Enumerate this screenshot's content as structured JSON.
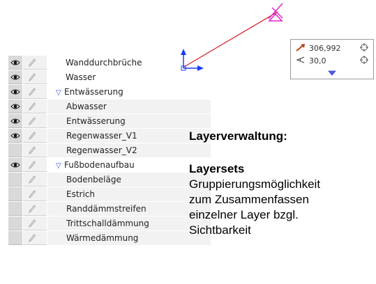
{
  "coord_box": {
    "length_value": "306,992",
    "angle_value": "30,0",
    "length_icon": "length-arrow-icon",
    "angle_icon": "angle-icon",
    "target_icon": "crosshair-icon",
    "expand_icon": "expand-triangle-icon"
  },
  "layers": [
    {
      "name": "Wanddurchbrüche",
      "visible": true,
      "group": false,
      "indent": 0
    },
    {
      "name": "Wasser",
      "visible": true,
      "group": false,
      "indent": 0
    },
    {
      "name": "Entwässerung",
      "visible": true,
      "group": true,
      "indent": 0
    },
    {
      "name": "Abwasser",
      "visible": true,
      "group": false,
      "indent": 1
    },
    {
      "name": "Entwässerung",
      "visible": true,
      "group": false,
      "indent": 1
    },
    {
      "name": "Regenwasser_V1",
      "visible": true,
      "group": false,
      "indent": 1
    },
    {
      "name": "Regenwasser_V2",
      "visible": false,
      "group": false,
      "indent": 1
    },
    {
      "name": "Fußbodenaufbau",
      "visible": true,
      "group": true,
      "indent": 0
    },
    {
      "name": "Bodenbeläge",
      "visible": false,
      "group": false,
      "indent": 1
    },
    {
      "name": "Estrich",
      "visible": false,
      "group": false,
      "indent": 1
    },
    {
      "name": "Randdämmstreifen",
      "visible": false,
      "group": false,
      "indent": 1
    },
    {
      "name": "Trittschalldämmung",
      "visible": false,
      "group": false,
      "indent": 1
    },
    {
      "name": "Wärmedämmung",
      "visible": false,
      "group": false,
      "indent": 1
    }
  ],
  "info": {
    "title": "Layerverwaltung:",
    "subtitle": "Layersets",
    "body_lines": [
      "Gruppierungsmöglichkeit",
      "zum Zusammenfassen",
      "einzelner Layer bzgl.",
      "Sichtbarkeit"
    ]
  },
  "colors": {
    "drawn_line": "#d9202a",
    "cursor_marker": "#e020c8",
    "axis_arrow": "#1a3cff",
    "group_triangle": "#3050d0"
  },
  "icons": {
    "visibility": "eye-icon",
    "lock": "pencil-icon"
  }
}
